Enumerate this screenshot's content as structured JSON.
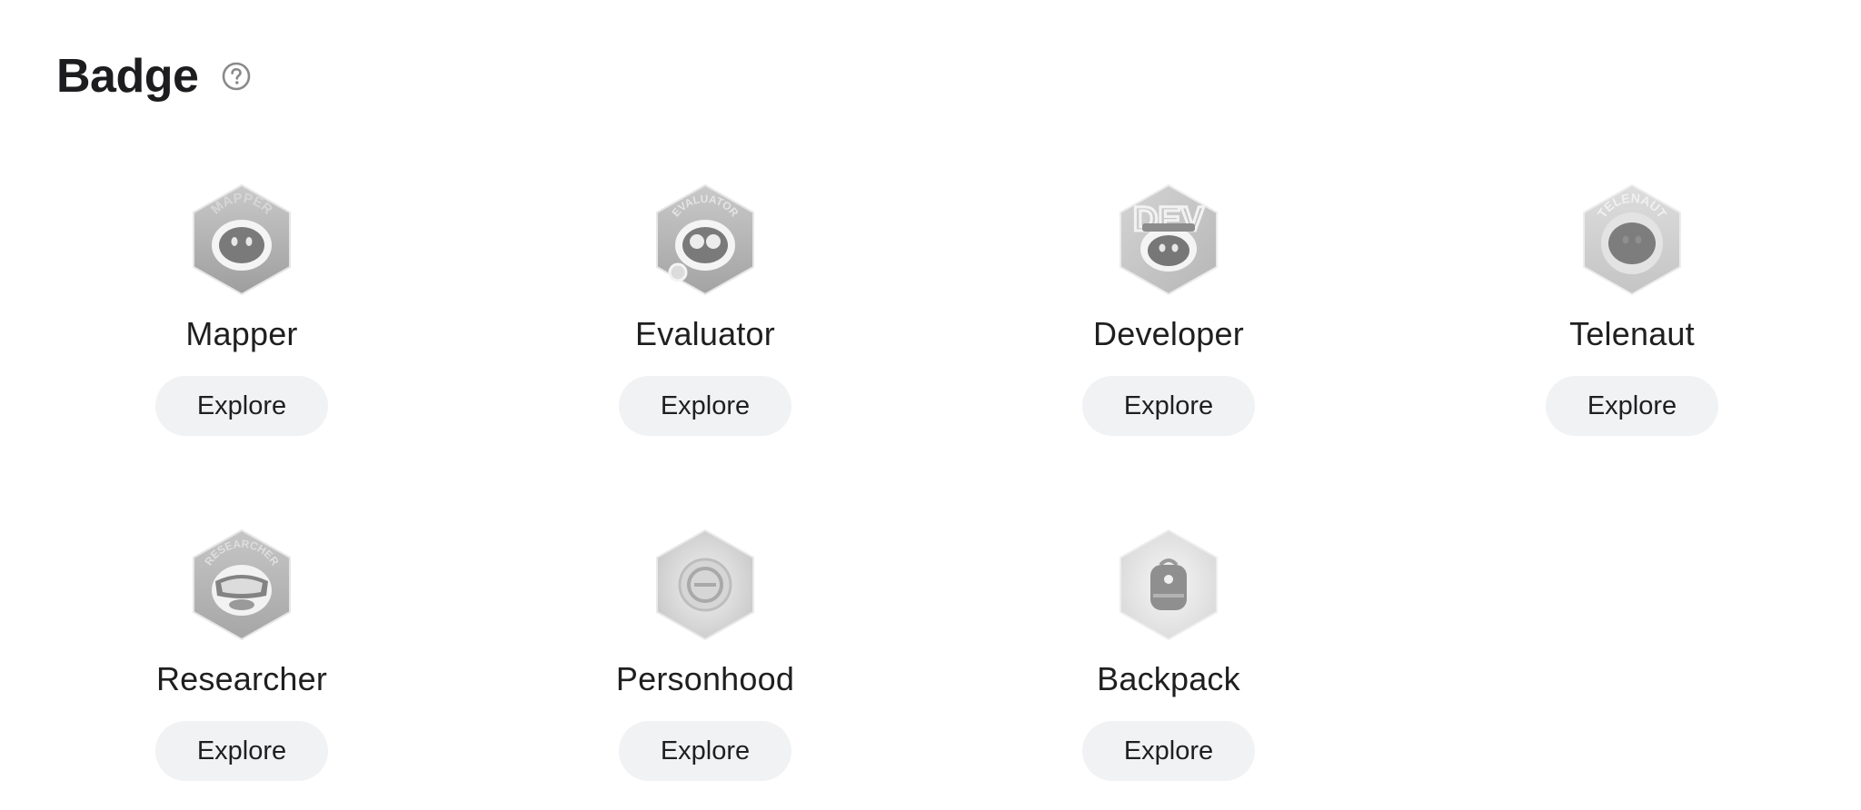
{
  "section": {
    "title": "Badge",
    "help_icon": "question-circle-icon"
  },
  "badges": [
    {
      "name": "Mapper",
      "ring_text": "MAPPER",
      "button": "Explore",
      "icon": "mapper-badge-icon"
    },
    {
      "name": "Evaluator",
      "ring_text": "EVALUATOR",
      "button": "Explore",
      "icon": "evaluator-badge-icon"
    },
    {
      "name": "Developer",
      "ring_text": "DEV",
      "button": "Explore",
      "icon": "developer-badge-icon"
    },
    {
      "name": "Telenaut",
      "ring_text": "TELENAUT",
      "button": "Explore",
      "icon": "telenaut-badge-icon"
    },
    {
      "name": "Researcher",
      "ring_text": "RESEARCHER",
      "button": "Explore",
      "icon": "researcher-badge-icon"
    },
    {
      "name": "Personhood",
      "ring_text": "",
      "button": "Explore",
      "icon": "personhood-badge-icon"
    },
    {
      "name": "Backpack",
      "ring_text": "",
      "button": "Explore",
      "icon": "backpack-badge-icon"
    }
  ],
  "colors": {
    "button_bg": "#f1f2f4",
    "text": "#1f1f1f",
    "badge_gray": "#a8a8a8"
  }
}
